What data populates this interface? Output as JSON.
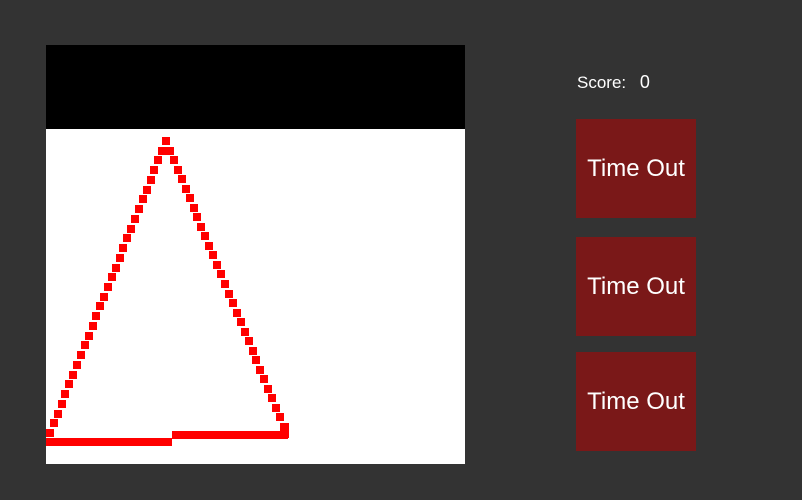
{
  "score": {
    "label": "Score:",
    "value": "0"
  },
  "answer_buttons": [
    {
      "label": "Time Out"
    },
    {
      "label": "Time Out"
    },
    {
      "label": "Time Out"
    }
  ],
  "colors": {
    "background": "#333333",
    "board": "#ffffff",
    "board_header": "#000000",
    "stroke": "#ff0000",
    "button": "#7a1818",
    "text": "#ffffff"
  },
  "drawing": {
    "shape": "triangle",
    "stroke_color": "#ff0000"
  }
}
